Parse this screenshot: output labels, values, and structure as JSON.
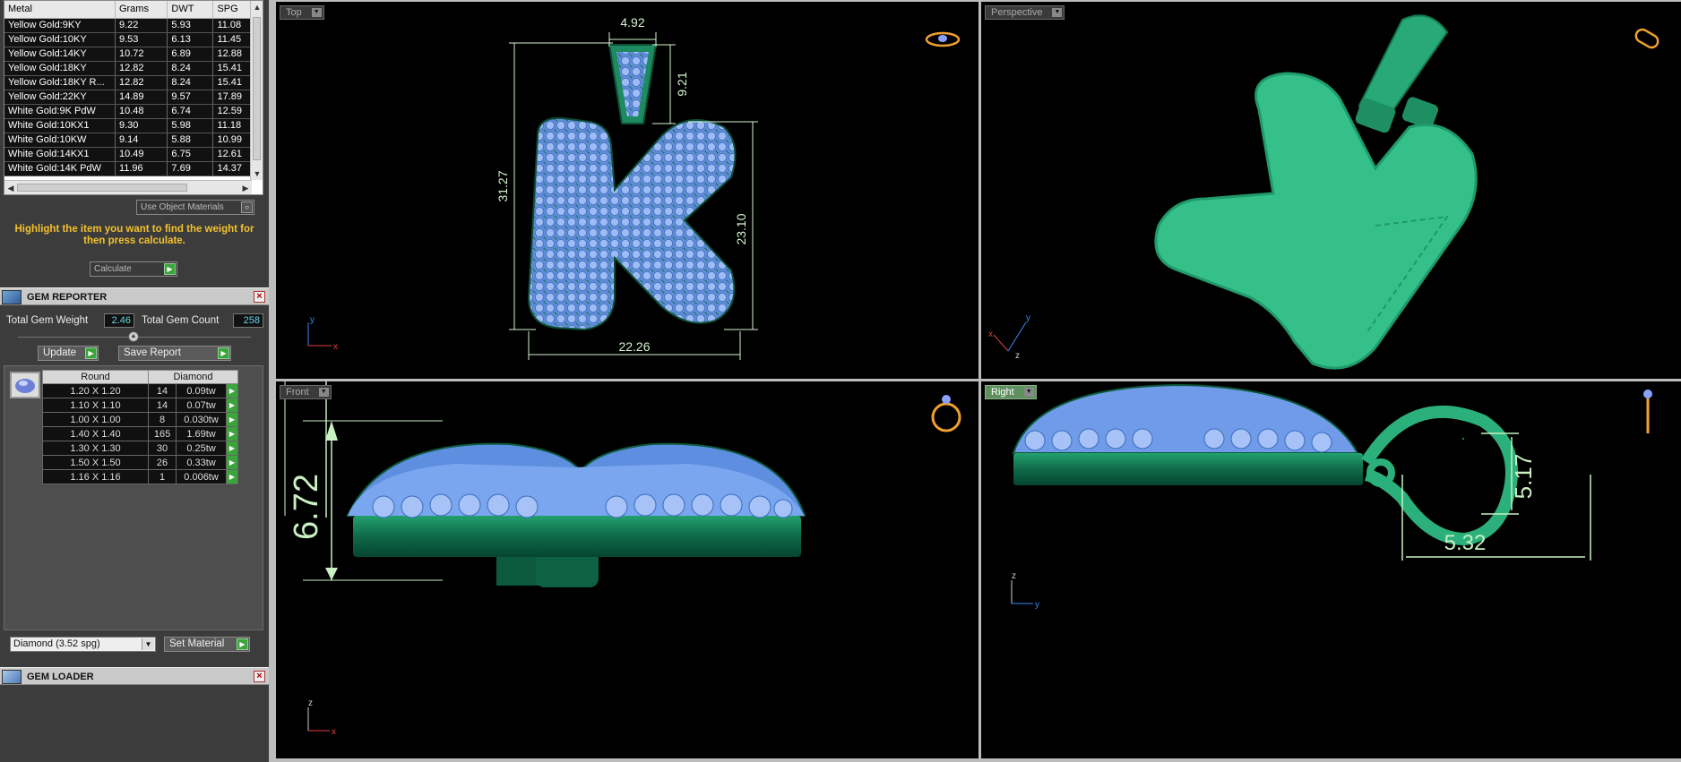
{
  "metal_table": {
    "columns": [
      "Metal",
      "Grams",
      "DWT",
      "SPG"
    ],
    "rows": [
      [
        "Yellow Gold:9KY",
        "9.22",
        "5.93",
        "11.08"
      ],
      [
        "Yellow Gold:10KY",
        "9.53",
        "6.13",
        "11.45"
      ],
      [
        "Yellow Gold:14KY",
        "10.72",
        "6.89",
        "12.88"
      ],
      [
        "Yellow Gold:18KY",
        "12.82",
        "8.24",
        "15.41"
      ],
      [
        "Yellow Gold:18KY R...",
        "12.82",
        "8.24",
        "15.41"
      ],
      [
        "Yellow Gold:22KY",
        "14.89",
        "9.57",
        "17.89"
      ],
      [
        "White Gold:9K PdW",
        "10.48",
        "6.74",
        "12.59"
      ],
      [
        "White Gold:10KX1",
        "9.30",
        "5.98",
        "11.18"
      ],
      [
        "White Gold:10KW",
        "9.14",
        "5.88",
        "10.99"
      ],
      [
        "White Gold:14KX1",
        "10.49",
        "6.75",
        "12.61"
      ],
      [
        "White Gold:14K PdW",
        "11.96",
        "7.69",
        "14.37"
      ]
    ]
  },
  "use_object_materials": "Use Object Materials",
  "hint_text": "Highlight the item you want to find the weight for then press calculate.",
  "calculate_label": "Calculate",
  "gem_reporter": {
    "title": "GEM REPORTER",
    "total_weight_label": "Total Gem Weight",
    "total_weight": "2.46",
    "total_count_label": "Total Gem Count",
    "total_count": "258",
    "update_label": "Update",
    "save_report_label": "Save Report",
    "columns": [
      "Round",
      "Diamond"
    ],
    "rows": [
      [
        "1.20 X 1.20",
        "14",
        "0.09tw"
      ],
      [
        "1.10 X 1.10",
        "14",
        "0.07tw"
      ],
      [
        "1.00 X 1.00",
        "8",
        "0.030tw"
      ],
      [
        "1.40 X 1.40",
        "165",
        "1.69tw"
      ],
      [
        "1.30 X 1.30",
        "30",
        "0.25tw"
      ],
      [
        "1.50 X 1.50",
        "26",
        "0.33tw"
      ],
      [
        "1.16 X 1.16",
        "1",
        "0.006tw"
      ]
    ],
    "material_select": "Diamond    (3.52 spg)",
    "set_material_label": "Set Material"
  },
  "gem_loader": {
    "title": "GEM LOADER"
  },
  "viewports": {
    "top": {
      "label": "Top",
      "dims": {
        "bail_width": "4.92",
        "bail_height": "9.21",
        "height": "31.27",
        "right_height": "23.10",
        "width": "22.26"
      }
    },
    "perspective": {
      "label": "Perspective"
    },
    "front": {
      "label": "Front",
      "dims": {
        "height": "6.72"
      }
    },
    "right": {
      "label": "Right",
      "dims": {
        "bail_height": "5.17",
        "bail_depth": "5.32"
      }
    }
  },
  "colors": {
    "metal": "#2ec08a",
    "gem": "#7fa9f2",
    "dimension": "#d6f5cf",
    "ring_icon": "#f0a030"
  }
}
